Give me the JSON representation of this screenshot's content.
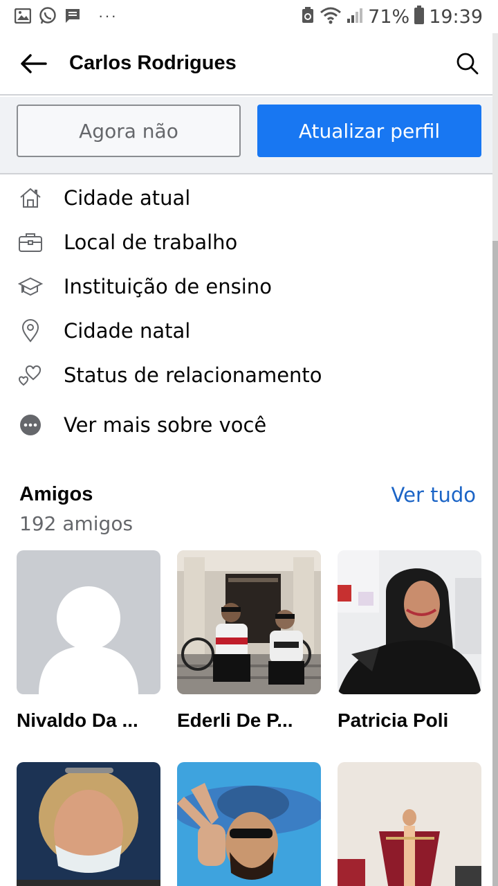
{
  "status_bar": {
    "battery": "71%",
    "time": "19:39",
    "dots": "···"
  },
  "header": {
    "title": "Carlos Rodrigues"
  },
  "actions": {
    "secondary_label": "Agora não",
    "primary_label": "Atualizar perfil"
  },
  "info_items": [
    {
      "label": "Cidade atual",
      "icon": "home-icon"
    },
    {
      "label": "Local de trabalho",
      "icon": "briefcase-icon"
    },
    {
      "label": "Instituição de ensino",
      "icon": "graduation-cap-icon"
    },
    {
      "label": "Cidade natal",
      "icon": "location-pin-icon"
    },
    {
      "label": "Status de relacionamento",
      "icon": "hearts-icon"
    },
    {
      "label": "Ver mais sobre você",
      "icon": "more-dots-icon"
    }
  ],
  "friends": {
    "title": "Amigos",
    "count": "192 amigos",
    "see_all": "Ver tudo",
    "list": [
      {
        "name": "Nivaldo Da ...",
        "photo": "default-avatar"
      },
      {
        "name": "Ederli De P...",
        "photo": "cyclists-photo"
      },
      {
        "name": "Patricia Poli",
        "photo": "woman-selfie-photo"
      },
      {
        "name": "",
        "photo": "woman-mask-photo"
      },
      {
        "name": "",
        "photo": "man-hat-photo"
      },
      {
        "name": "",
        "photo": "figurine-photo"
      }
    ]
  },
  "colors": {
    "accent": "#1877f2",
    "link": "#1b64c6",
    "secondary_text": "#65676b",
    "divider_bg": "#f0f2f5"
  }
}
